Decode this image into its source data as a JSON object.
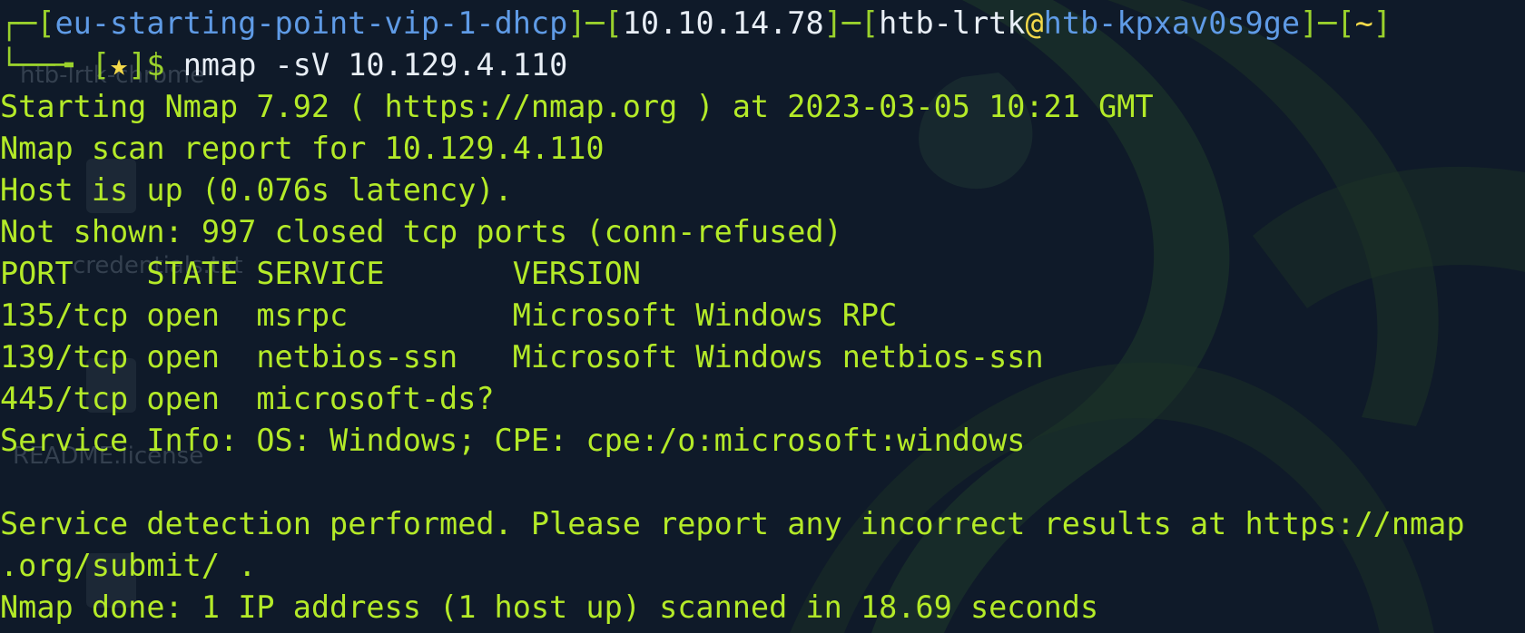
{
  "desktop_ghost_labels": [
    "htb-lrtk-chrome",
    "credentials.txt",
    "README.license"
  ],
  "prompt": {
    "corner_top": "┌─",
    "open1": "[",
    "vpn": "eu-starting-point-vip-1-dhcp",
    "close_open": "]─[",
    "ip": "10.10.14.78",
    "close_open2": "]─[",
    "user": "htb-lrtk",
    "at": "@",
    "host": "htb-kpxav0s9ge",
    "close_open3": "]─[",
    "cwd": "~",
    "close_end": "]",
    "corner_bottom": "└──╼ ",
    "star_open": "[",
    "star": "★",
    "star_close": "]$ ",
    "command": "nmap -sV 10.129.4.110"
  },
  "output": [
    "Starting Nmap 7.92 ( https://nmap.org ) at 2023-03-05 10:21 GMT",
    "Nmap scan report for 10.129.4.110",
    "Host is up (0.076s latency).",
    "Not shown: 997 closed tcp ports (conn-refused)",
    "PORT    STATE SERVICE       VERSION",
    "135/tcp open  msrpc         Microsoft Windows RPC",
    "139/tcp open  netbios-ssn   Microsoft Windows netbios-ssn",
    "445/tcp open  microsoft-ds?",
    "Service Info: OS: Windows; CPE: cpe:/o:microsoft:windows",
    "",
    "Service detection performed. Please report any incorrect results at https://nmap",
    ".org/submit/ .",
    "Nmap done: 1 IP address (1 host up) scanned in 18.69 seconds"
  ]
}
